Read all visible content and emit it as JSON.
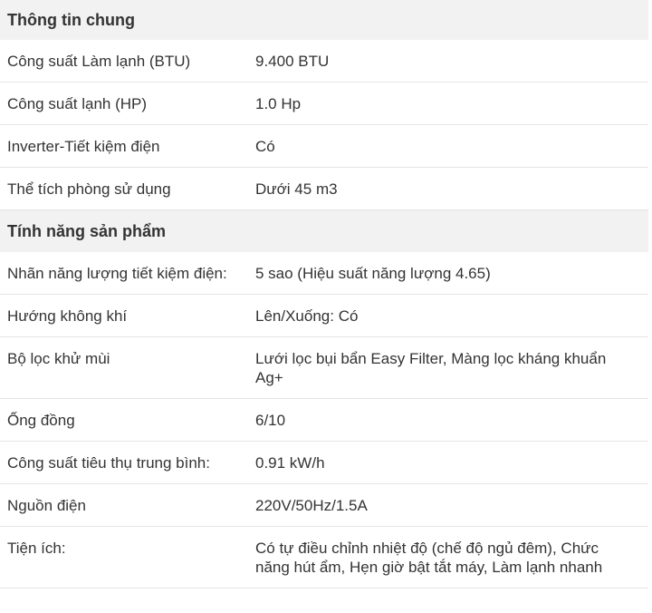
{
  "sections": [
    {
      "title": "Thông tin chung",
      "rows": [
        {
          "label": "Công suất Làm lạnh (BTU)",
          "value": "9.400 BTU"
        },
        {
          "label": "Công suất lạnh (HP)",
          "value": "1.0 Hp"
        },
        {
          "label": "Inverter-Tiết kiệm điện",
          "value": "Có"
        },
        {
          "label": "Thể tích phòng sử dụng",
          "value": "Dưới 45 m3"
        }
      ]
    },
    {
      "title": "Tính năng sản phẩm",
      "rows": [
        {
          "label": "Nhãn năng lượng tiết kiệm điện:",
          "value": "5 sao (Hiệu suất năng lượng 4.65)"
        },
        {
          "label": "Hướng không khí",
          "value": "Lên/Xuống: Có"
        },
        {
          "label": "Bộ lọc khử mùi",
          "value": "Lưới lọc bụi bẩn Easy Filter, Màng lọc kháng khuẩn Ag+"
        },
        {
          "label": "Ống đồng",
          "value": "6/10"
        },
        {
          "label": "Công suất tiêu thụ trung bình:",
          "value": "0.91 kW/h"
        },
        {
          "label": "Nguồn điện",
          "value": "220V/50Hz/1.5A"
        },
        {
          "label": "Tiện ích:",
          "value": "Có tự điều chỉnh nhiệt độ (chế độ ngủ đêm), Chức năng hút ẩm, Hẹn giờ bật tắt máy, Làm lạnh nhanh"
        }
      ]
    }
  ]
}
